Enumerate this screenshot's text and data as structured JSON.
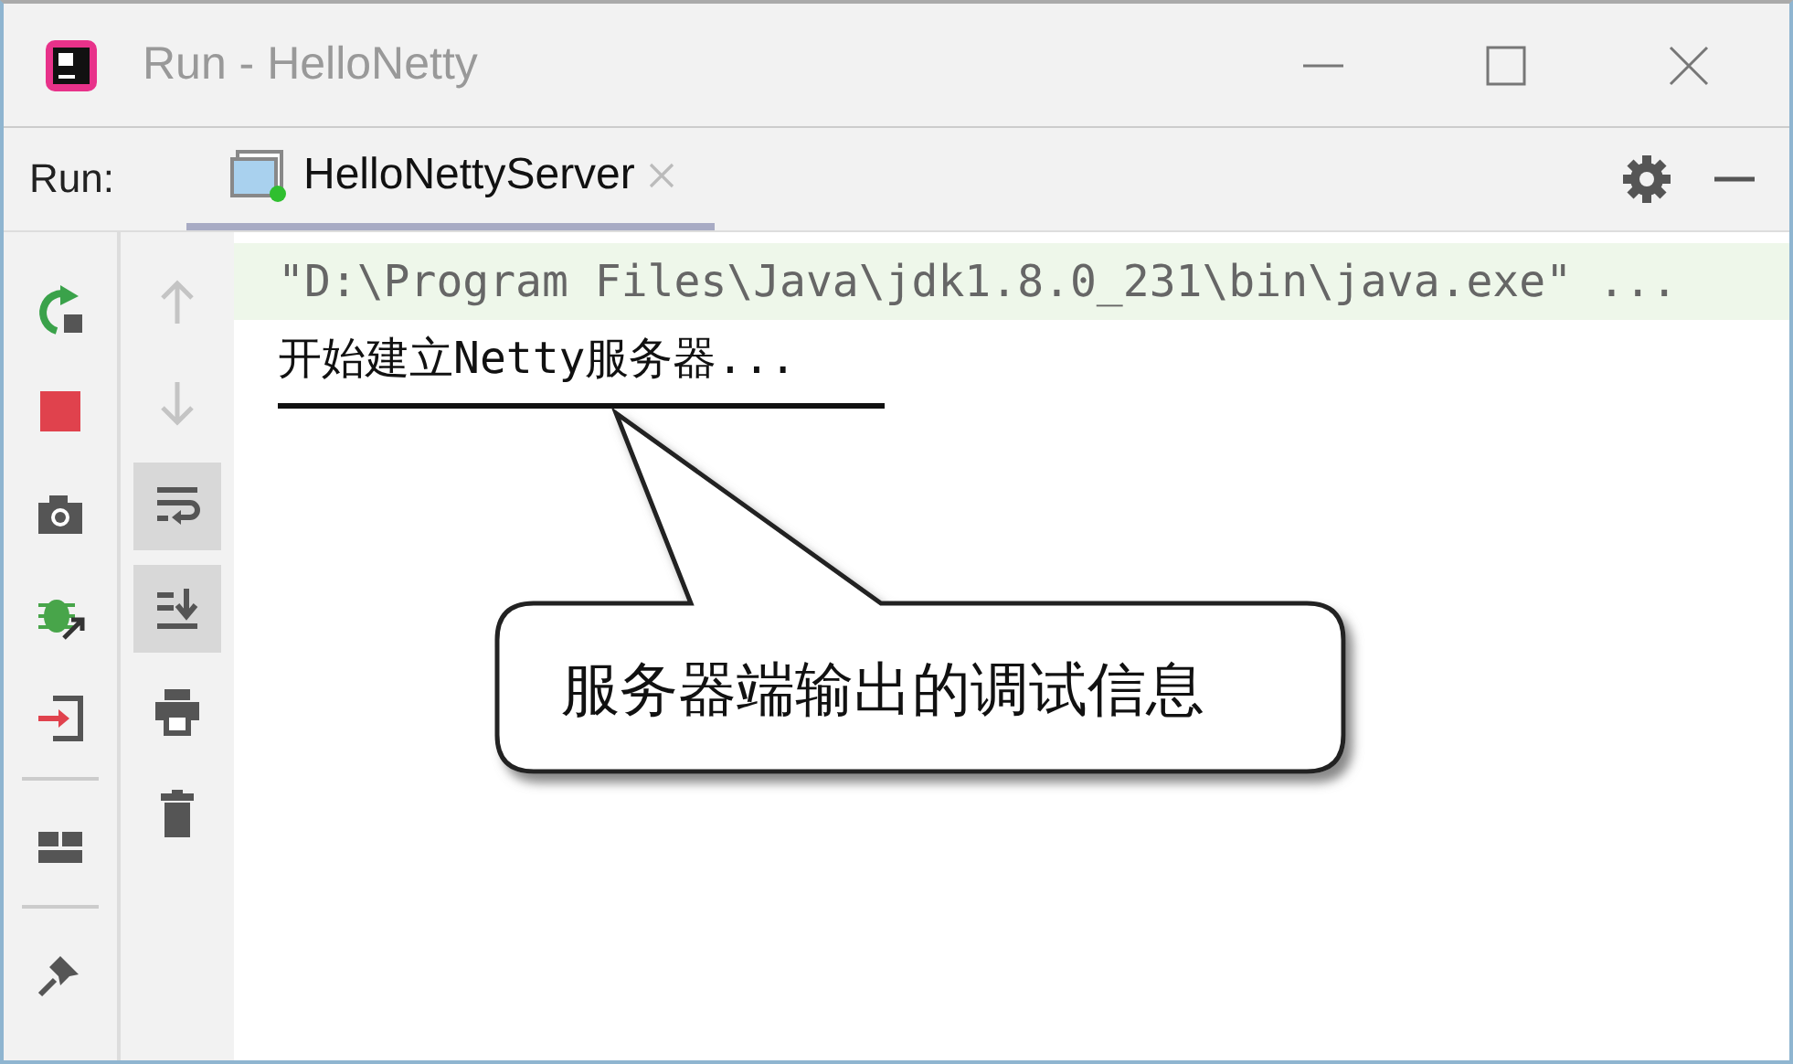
{
  "window": {
    "title": "Run - HelloNetty"
  },
  "run_label": "Run:",
  "tabs": [
    {
      "label": "HelloNettyServer",
      "selected": true,
      "running": true
    }
  ],
  "left_toolbar": [
    {
      "kind": "rerun"
    },
    {
      "kind": "stop"
    },
    {
      "kind": "camera"
    },
    {
      "kind": "debug"
    },
    {
      "kind": "exit"
    },
    {
      "kind": "separator"
    },
    {
      "kind": "layout"
    },
    {
      "kind": "separator"
    },
    {
      "kind": "pin"
    }
  ],
  "console_toolbar": [
    {
      "kind": "up",
      "disabled": true,
      "on": false
    },
    {
      "kind": "down",
      "disabled": true,
      "on": false
    },
    {
      "kind": "wrap",
      "disabled": false,
      "on": true
    },
    {
      "kind": "scroll",
      "disabled": false,
      "on": true
    },
    {
      "kind": "print",
      "disabled": false,
      "on": false
    },
    {
      "kind": "trash",
      "disabled": false,
      "on": false
    }
  ],
  "console_lines": [
    {
      "kind": "command",
      "text": "\"D:\\Program Files\\Java\\jdk1.8.0_231\\bin\\java.exe\" ..."
    },
    {
      "kind": "output",
      "text": "开始建立Netty服务器..."
    }
  ],
  "callout": {
    "text": "服务器端输出的调试信息"
  }
}
